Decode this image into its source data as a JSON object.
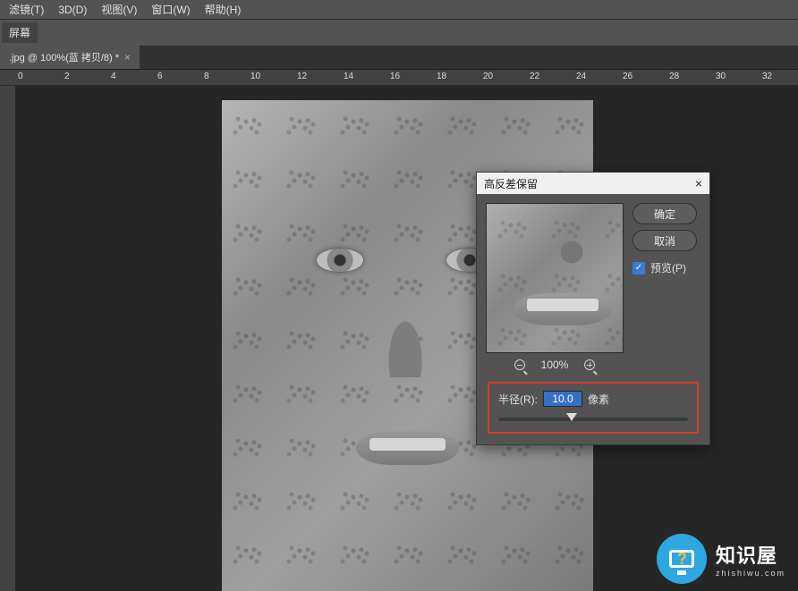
{
  "menu": {
    "items": [
      "滤镜(T)",
      "3D(D)",
      "视图(V)",
      "窗口(W)",
      "帮助(H)"
    ]
  },
  "toolbar": {
    "label": "屏幕"
  },
  "tab": {
    "title": ".jpg @ 100%(蓝 拷贝/8) *",
    "close": "×"
  },
  "ruler": {
    "marks": [
      "0",
      "2",
      "4",
      "6",
      "8",
      "10",
      "12",
      "14",
      "16",
      "18",
      "20",
      "22",
      "24",
      "26",
      "28",
      "30",
      "32"
    ]
  },
  "dialog": {
    "title": "高反差保留",
    "close": "×",
    "ok": "确定",
    "cancel": "取消",
    "preview_label": "预览(P)",
    "preview_checked": true,
    "zoom_level": "100%",
    "radius_label": "半径(R):",
    "radius_value": "10.0",
    "radius_unit": "像素"
  },
  "watermark": {
    "name": "知识屋",
    "url": "zhishiwu.com"
  }
}
